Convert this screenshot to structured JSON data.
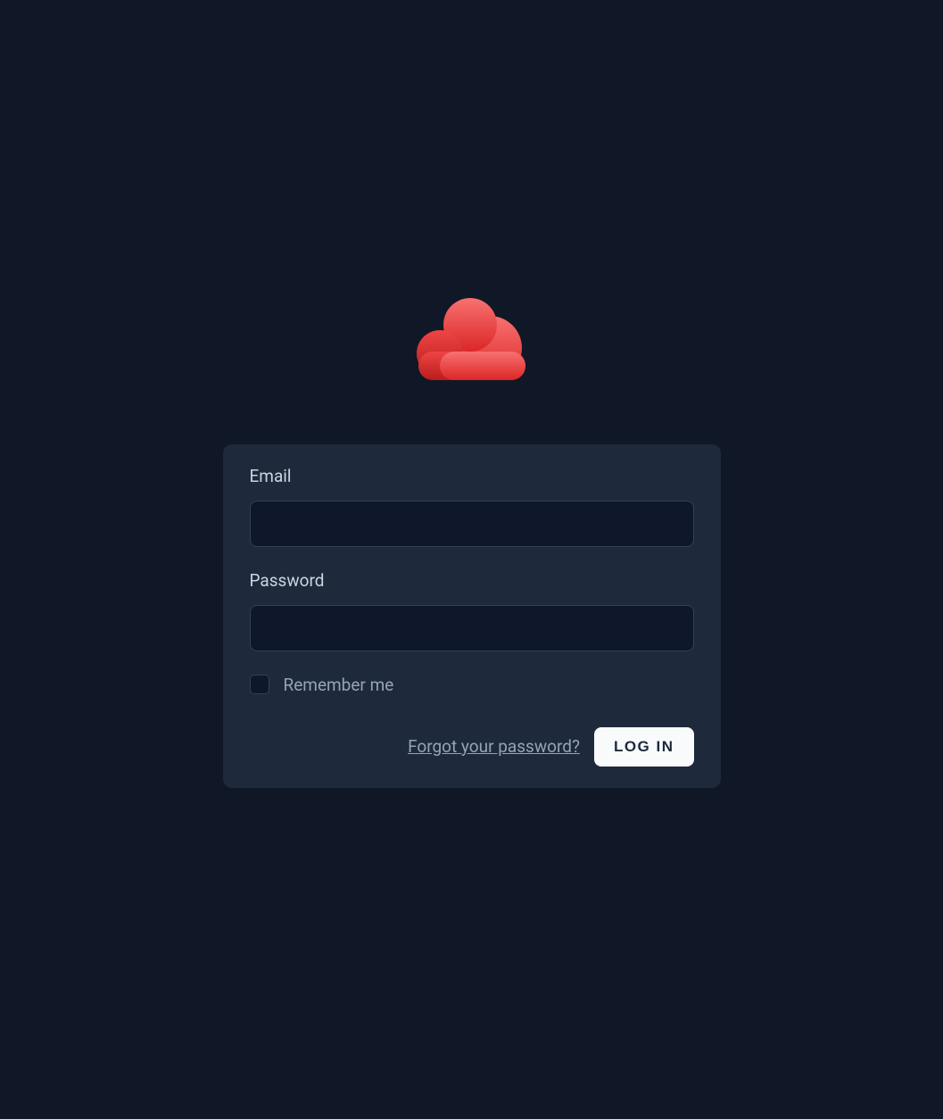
{
  "form": {
    "email_label": "Email",
    "password_label": "Password",
    "remember_label": "Remember me",
    "forgot_link": "Forgot your password?",
    "login_button": "LOG IN",
    "email_value": "",
    "password_value": ""
  },
  "logo": {
    "name": "cloud-icon"
  }
}
